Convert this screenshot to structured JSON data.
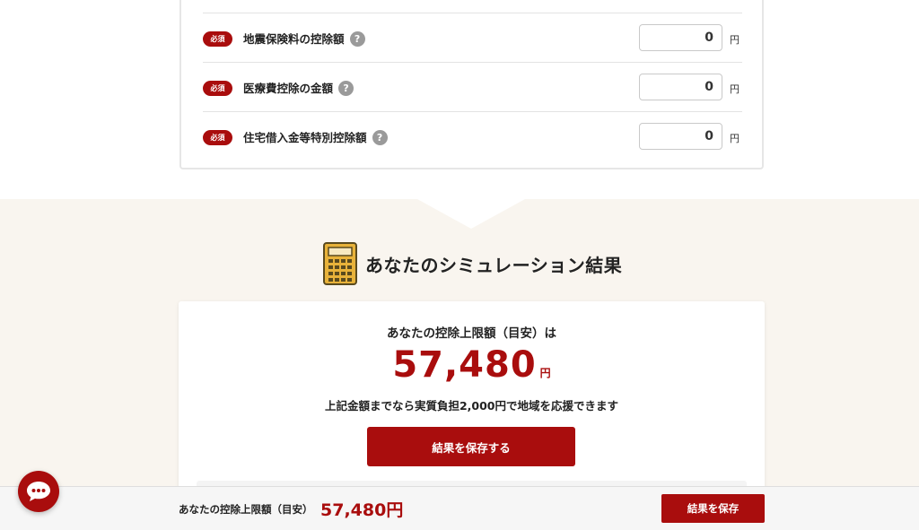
{
  "form": {
    "required_badge": "必須",
    "help_glyph": "?",
    "unit": "円",
    "rows": [
      {
        "label": "地震保険料の控除額",
        "value": "0"
      },
      {
        "label": "医療費控除の金額",
        "value": "0"
      },
      {
        "label": "住宅借入金等特別控除額",
        "value": "0"
      }
    ]
  },
  "result": {
    "heading": "あなたのシミュレーション結果",
    "icon": "calculator-icon",
    "subheading": "あなたの控除上限額（目安）は",
    "amount": "57,480",
    "amount_unit": "円",
    "note": "上記金額までなら実質負担2,000円で地域を応援できます",
    "save_button": "結果を保存する"
  },
  "sticky_bar": {
    "label": "あなたの控除上限額（目安）",
    "amount": "57,480円",
    "save_button": "結果を保存"
  },
  "chat": {
    "icon": "chat-bubble-icon"
  },
  "colors": {
    "accent": "#a90d0d",
    "band_background": "#f9f5ef",
    "bar_background": "#f6f6f6"
  }
}
